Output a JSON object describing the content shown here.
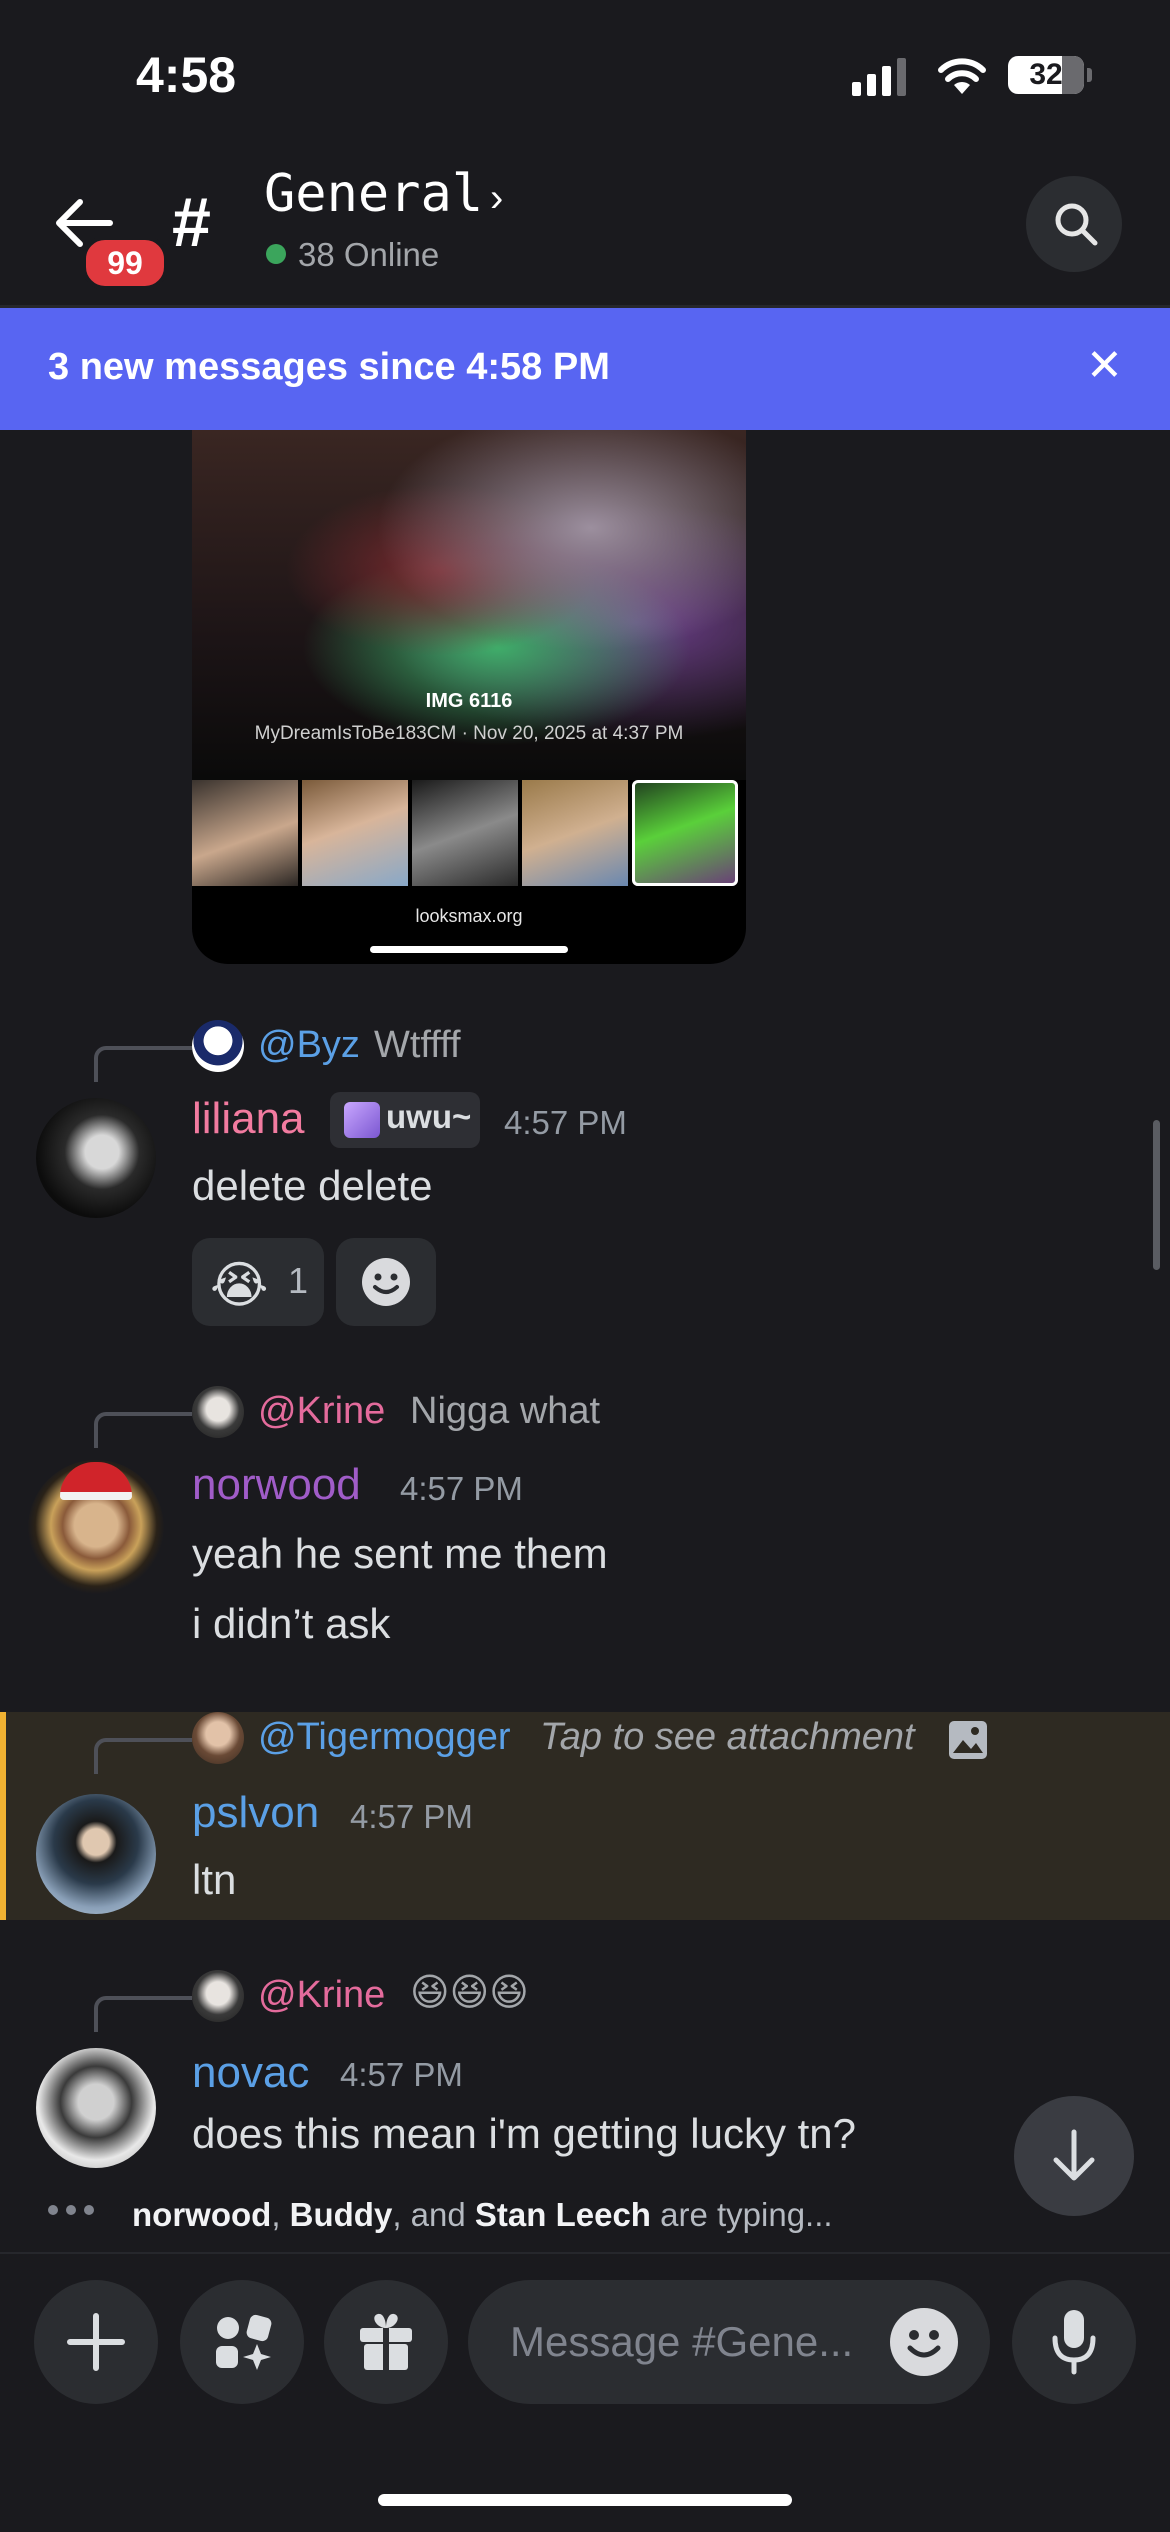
{
  "status_bar": {
    "time": "4:58",
    "battery": "32"
  },
  "header": {
    "unread_count": "99",
    "channel_name": "General",
    "online": "38 Online"
  },
  "banner": {
    "text": "3 new messages since 4:58 PM"
  },
  "embed": {
    "title": "IMG 6116",
    "meta": "MyDreamIsToBe183CM · Nov 20, 2025 at 4:37 PM",
    "domain": "looksmax.org"
  },
  "messages": [
    {
      "reply_name": "@Byz",
      "reply_text": "Wtffff",
      "author": "liliana",
      "tag": "uwu~",
      "time": "4:57 PM",
      "lines": [
        "delete delete"
      ],
      "reaction": {
        "emoji": "😭",
        "count": "1"
      }
    },
    {
      "reply_name": "@Krine",
      "reply_text": "Nigga what",
      "author": "norwood",
      "time": "4:57 PM",
      "lines": [
        "yeah he sent me them",
        "i didn’t ask"
      ]
    },
    {
      "reply_name": "@Tigermogger",
      "reply_text": "Tap to see attachment",
      "author": "pslvon",
      "time": "4:57 PM",
      "lines": [
        "ltn"
      ]
    },
    {
      "reply_name": "@Krine",
      "reply_text": "😆😆😆",
      "author": "novac",
      "time": "4:57 PM",
      "lines": [
        "does this mean i'm getting lucky tn?"
      ]
    }
  ],
  "typing": {
    "user1": "norwood",
    "sep1": ", ",
    "user2": "Buddy",
    "sep2": ", and ",
    "user3": "Stan Leech",
    "suffix": " are typing..."
  },
  "composer": {
    "placeholder": "Message #Gene..."
  },
  "colors": {
    "accent": "#5865f2",
    "online": "#3ba55c",
    "badge": "#e0393e",
    "mention_blue": "#5ba0e6",
    "mention_pink": "#e46b9c",
    "liliana": "#f27ba0",
    "norwood": "#a05cc8",
    "pslvon": "#5ba0e6",
    "novac": "#5ba0e6"
  }
}
